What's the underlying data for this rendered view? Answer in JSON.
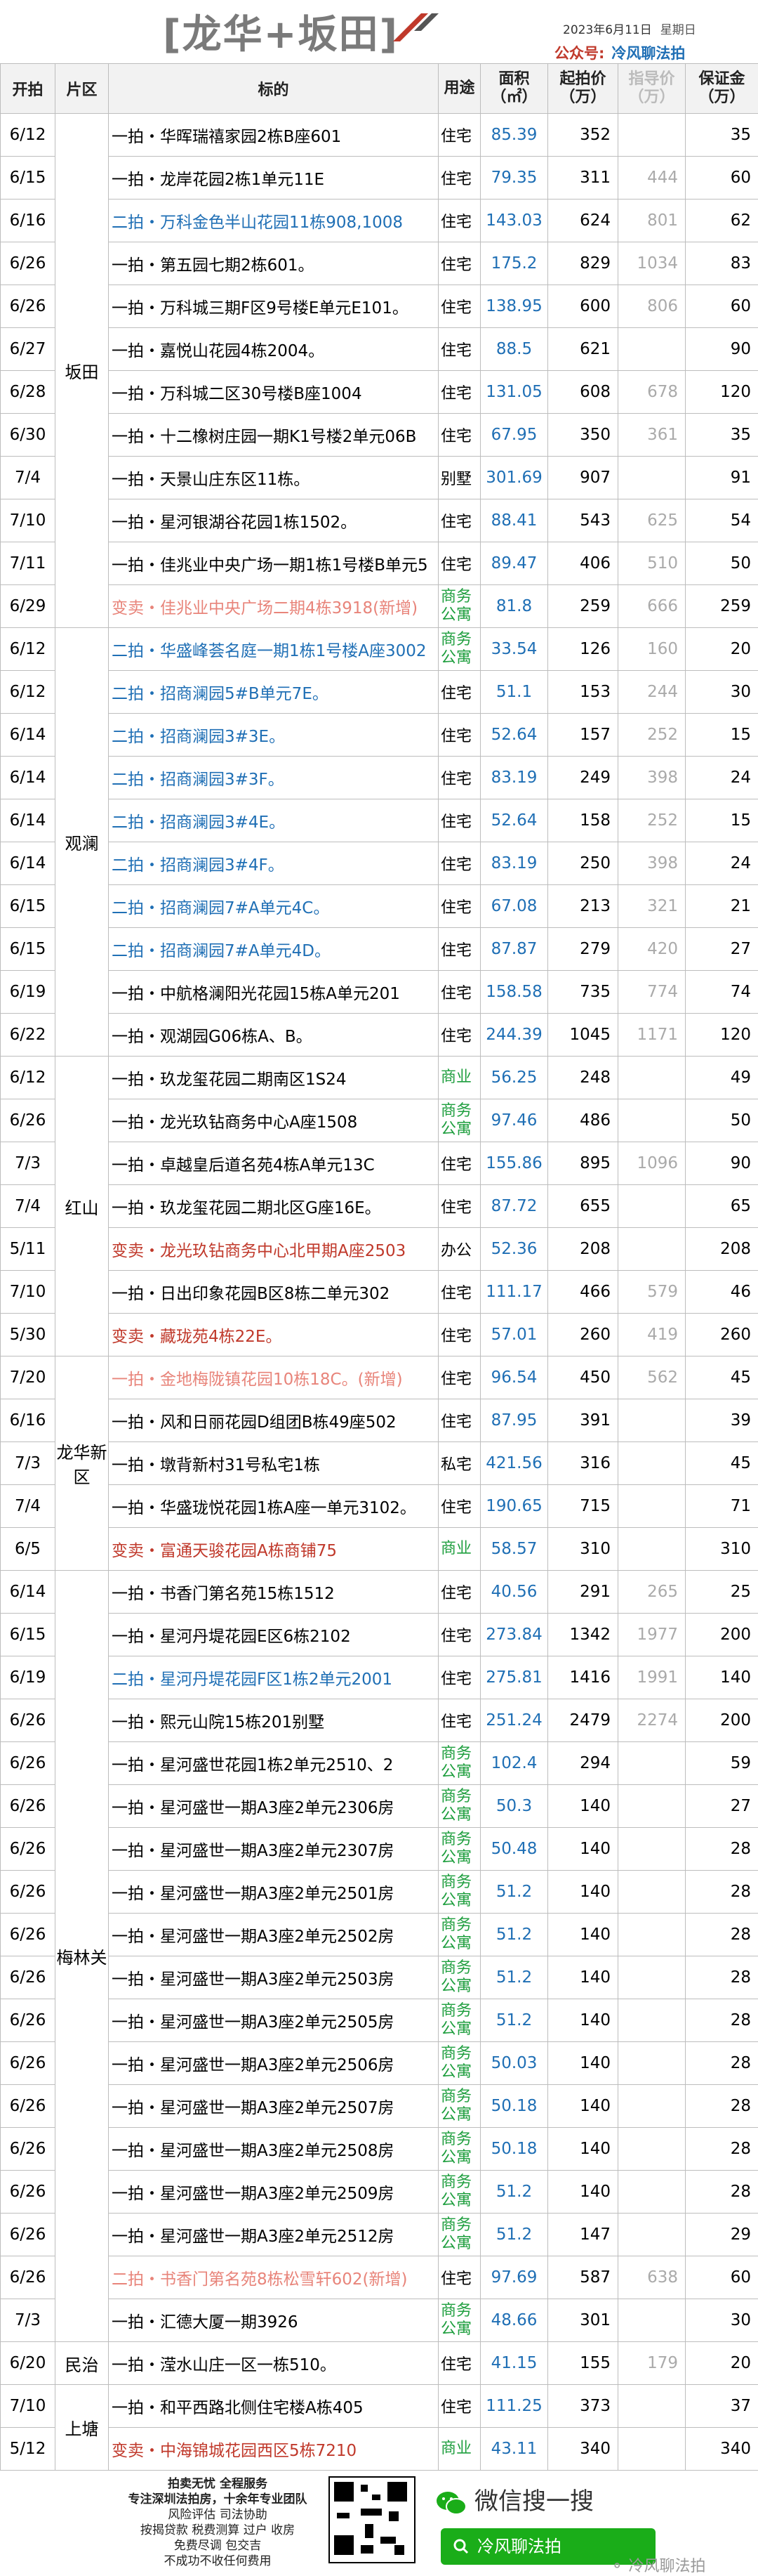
{
  "header": {
    "title": "[龙华+坂田]",
    "date": "2023年6月11日",
    "weekday": "星期日",
    "account_label": "公众号:",
    "account_name": "冷风聊法拍"
  },
  "columns": {
    "date": "开拍",
    "district": "片区",
    "name": "标的",
    "use": "用途",
    "area": "面积（㎡）",
    "start": "起拍价（万）",
    "guide": "指导价（万）",
    "deposit": "保证金（万）"
  },
  "groups": [
    {
      "district": "坂田",
      "rows": [
        {
          "date": "6/12",
          "name": "一拍・华晖瑞禧家园2栋B座601",
          "use": "住宅",
          "area": "85.39",
          "start": "352",
          "guide": "",
          "deposit": "35",
          "style": "normal"
        },
        {
          "date": "6/15",
          "name": "一拍・龙岸花园2栋1单元11E",
          "use": "住宅",
          "area": "79.35",
          "start": "311",
          "guide": "444",
          "deposit": "60",
          "style": "normal"
        },
        {
          "date": "6/16",
          "name": "二拍・万科金色半山花园11栋908,1008",
          "use": "住宅",
          "area": "143.03",
          "start": "624",
          "guide": "801",
          "deposit": "62",
          "style": "blue"
        },
        {
          "date": "6/26",
          "name": "一拍・第五园七期2栋601。",
          "use": "住宅",
          "area": "175.2",
          "start": "829",
          "guide": "1034",
          "deposit": "83",
          "style": "normal"
        },
        {
          "date": "6/26",
          "name": "一拍・万科城三期F区9号楼E单元E101。",
          "use": "住宅",
          "area": "138.95",
          "start": "600",
          "guide": "806",
          "deposit": "60",
          "style": "normal"
        },
        {
          "date": "6/27",
          "name": "一拍・嘉悦山花园4栋2004。",
          "use": "住宅",
          "area": "88.5",
          "start": "621",
          "guide": "",
          "deposit": "90",
          "style": "normal"
        },
        {
          "date": "6/28",
          "name": "一拍・万科城二区30号楼B座1004",
          "use": "住宅",
          "area": "131.05",
          "start": "608",
          "guide": "678",
          "deposit": "120",
          "style": "normal"
        },
        {
          "date": "6/30",
          "name": "一拍・十二橡树庄园一期K1号楼2单元06B",
          "use": "住宅",
          "area": "67.95",
          "start": "350",
          "guide": "361",
          "deposit": "35",
          "style": "normal"
        },
        {
          "date": "7/4",
          "name": "一拍・天景山庄东区11栋。",
          "use": "别墅",
          "area": "301.69",
          "start": "907",
          "guide": "",
          "deposit": "91",
          "style": "normal"
        },
        {
          "date": "7/10",
          "name": "一拍・星河银湖谷花园1栋1502。",
          "use": "住宅",
          "area": "88.41",
          "start": "543",
          "guide": "625",
          "deposit": "54",
          "style": "normal"
        },
        {
          "date": "7/11",
          "name": "一拍・佳兆业中央广场一期1栋1号楼B单元5",
          "use": "住宅",
          "area": "89.47",
          "start": "406",
          "guide": "510",
          "deposit": "50",
          "style": "normal"
        },
        {
          "date": "6/29",
          "name": "变卖・佳兆业中央广场二期4栋3918(新增)",
          "use": "商务公寓",
          "area": "81.8",
          "start": "259",
          "guide": "666",
          "deposit": "259",
          "style": "pink"
        }
      ]
    },
    {
      "district": "观澜",
      "rows": [
        {
          "date": "6/12",
          "name": "二拍・华盛峰荟名庭一期1栋1号楼A座3002",
          "use": "商务公寓",
          "area": "33.54",
          "start": "126",
          "guide": "160",
          "deposit": "20",
          "style": "blue"
        },
        {
          "date": "6/12",
          "name": "二拍・招商澜园5#B单元7E。",
          "use": "住宅",
          "area": "51.1",
          "start": "153",
          "guide": "244",
          "deposit": "30",
          "style": "blue"
        },
        {
          "date": "6/14",
          "name": "二拍・招商澜园3#3E。",
          "use": "住宅",
          "area": "52.64",
          "start": "157",
          "guide": "252",
          "deposit": "15",
          "style": "blue"
        },
        {
          "date": "6/14",
          "name": "二拍・招商澜园3#3F。",
          "use": "住宅",
          "area": "83.19",
          "start": "249",
          "guide": "398",
          "deposit": "24",
          "style": "blue"
        },
        {
          "date": "6/14",
          "name": "二拍・招商澜园3#4E。",
          "use": "住宅",
          "area": "52.64",
          "start": "158",
          "guide": "252",
          "deposit": "15",
          "style": "blue"
        },
        {
          "date": "6/14",
          "name": "二拍・招商澜园3#4F。",
          "use": "住宅",
          "area": "83.19",
          "start": "250",
          "guide": "398",
          "deposit": "24",
          "style": "blue"
        },
        {
          "date": "6/15",
          "name": "二拍・招商澜园7#A单元4C。",
          "use": "住宅",
          "area": "67.08",
          "start": "213",
          "guide": "321",
          "deposit": "21",
          "style": "blue"
        },
        {
          "date": "6/15",
          "name": "二拍・招商澜园7#A单元4D。",
          "use": "住宅",
          "area": "87.87",
          "start": "279",
          "guide": "420",
          "deposit": "27",
          "style": "blue"
        },
        {
          "date": "6/19",
          "name": "一拍・中航格澜阳光花园15栋A单元201",
          "use": "住宅",
          "area": "158.58",
          "start": "735",
          "guide": "774",
          "deposit": "74",
          "style": "normal"
        },
        {
          "date": "6/22",
          "name": "一拍・观湖园G06栋A、B。",
          "use": "住宅",
          "area": "244.39",
          "start": "1045",
          "guide": "1171",
          "deposit": "120",
          "style": "normal"
        }
      ]
    },
    {
      "district": "红山",
      "rows": [
        {
          "date": "6/12",
          "name": "一拍・玖龙玺花园二期南区1S24",
          "use": "商业",
          "area": "56.25",
          "start": "248",
          "guide": "",
          "deposit": "49",
          "style": "normal"
        },
        {
          "date": "6/26",
          "name": "一拍・龙光玖钻商务中心A座1508",
          "use": "商务公寓",
          "area": "97.46",
          "start": "486",
          "guide": "",
          "deposit": "50",
          "style": "normal"
        },
        {
          "date": "7/3",
          "name": "一拍・卓越皇后道名苑4栋A单元13C",
          "use": "住宅",
          "area": "155.86",
          "start": "895",
          "guide": "1096",
          "deposit": "90",
          "style": "normal"
        },
        {
          "date": "7/4",
          "name": "一拍・玖龙玺花园二期北区G座16E。",
          "use": "住宅",
          "area": "87.72",
          "start": "655",
          "guide": "",
          "deposit": "65",
          "style": "normal"
        },
        {
          "date": "5/11",
          "name": "变卖・龙光玖钻商务中心北甲期A座2503",
          "use": "办公",
          "area": "52.36",
          "start": "208",
          "guide": "",
          "deposit": "208",
          "style": "red"
        },
        {
          "date": "7/10",
          "name": "一拍・日出印象花园B区8栋二单元302",
          "use": "住宅",
          "area": "111.17",
          "start": "466",
          "guide": "579",
          "deposit": "46",
          "style": "normal"
        },
        {
          "date": "5/30",
          "name": "变卖・藏珑苑4栋22E。",
          "use": "住宅",
          "area": "57.01",
          "start": "260",
          "guide": "419",
          "deposit": "260",
          "style": "red"
        }
      ]
    },
    {
      "district": "龙华新区",
      "rows": [
        {
          "date": "7/20",
          "name": "一拍・金地梅陇镇花园10栋18C。(新增)",
          "use": "住宅",
          "area": "96.54",
          "start": "450",
          "guide": "562",
          "deposit": "45",
          "style": "pink"
        },
        {
          "date": "6/16",
          "name": "一拍・风和日丽花园D组团B栋49座502",
          "use": "住宅",
          "area": "87.95",
          "start": "391",
          "guide": "",
          "deposit": "39",
          "style": "normal"
        },
        {
          "date": "7/3",
          "name": "一拍・墩背新村31号私宅1栋",
          "use": "私宅",
          "area": "421.56",
          "start": "316",
          "guide": "",
          "deposit": "45",
          "style": "normal"
        },
        {
          "date": "7/4",
          "name": "一拍・华盛珑悦花园1栋A座一单元3102。",
          "use": "住宅",
          "area": "190.65",
          "start": "715",
          "guide": "",
          "deposit": "71",
          "style": "normal"
        },
        {
          "date": "6/5",
          "name": "变卖・富通天骏花园A栋商铺75",
          "use": "商业",
          "area": "58.57",
          "start": "310",
          "guide": "",
          "deposit": "310",
          "style": "red"
        }
      ]
    },
    {
      "district": "梅林关",
      "rows": [
        {
          "date": "6/14",
          "name": "一拍・书香门第名苑15栋1512",
          "use": "住宅",
          "area": "40.56",
          "start": "291",
          "guide": "265",
          "deposit": "25",
          "style": "normal"
        },
        {
          "date": "6/15",
          "name": "一拍・星河丹堤花园E区6栋2102",
          "use": "住宅",
          "area": "273.84",
          "start": "1342",
          "guide": "1977",
          "deposit": "200",
          "style": "normal"
        },
        {
          "date": "6/19",
          "name": "二拍・星河丹堤花园F区1栋2单元2001",
          "use": "住宅",
          "area": "275.81",
          "start": "1416",
          "guide": "1991",
          "deposit": "140",
          "style": "blue"
        },
        {
          "date": "6/26",
          "name": "一拍・熙元山院15栋201别墅",
          "use": "住宅",
          "area": "251.24",
          "start": "2479",
          "guide": "2274",
          "deposit": "200",
          "style": "normal"
        },
        {
          "date": "6/26",
          "name": "一拍・星河盛世花园1栋2单元2510、2",
          "use": "商务公寓",
          "area": "102.4",
          "start": "294",
          "guide": "",
          "deposit": "59",
          "style": "normal"
        },
        {
          "date": "6/26",
          "name": "一拍・星河盛世一期A3座2单元2306房",
          "use": "商务公寓",
          "area": "50.3",
          "start": "140",
          "guide": "",
          "deposit": "27",
          "style": "normal"
        },
        {
          "date": "6/26",
          "name": "一拍・星河盛世一期A3座2单元2307房",
          "use": "商务公寓",
          "area": "50.48",
          "start": "140",
          "guide": "",
          "deposit": "28",
          "style": "normal"
        },
        {
          "date": "6/26",
          "name": "一拍・星河盛世一期A3座2单元2501房",
          "use": "商务公寓",
          "area": "51.2",
          "start": "140",
          "guide": "",
          "deposit": "28",
          "style": "normal"
        },
        {
          "date": "6/26",
          "name": "一拍・星河盛世一期A3座2单元2502房",
          "use": "商务公寓",
          "area": "51.2",
          "start": "140",
          "guide": "",
          "deposit": "28",
          "style": "normal"
        },
        {
          "date": "6/26",
          "name": "一拍・星河盛世一期A3座2单元2503房",
          "use": "商务公寓",
          "area": "51.2",
          "start": "140",
          "guide": "",
          "deposit": "28",
          "style": "normal"
        },
        {
          "date": "6/26",
          "name": "一拍・星河盛世一期A3座2单元2505房",
          "use": "商务公寓",
          "area": "51.2",
          "start": "140",
          "guide": "",
          "deposit": "28",
          "style": "normal"
        },
        {
          "date": "6/26",
          "name": "一拍・星河盛世一期A3座2单元2506房",
          "use": "商务公寓",
          "area": "50.03",
          "start": "140",
          "guide": "",
          "deposit": "28",
          "style": "normal"
        },
        {
          "date": "6/26",
          "name": "一拍・星河盛世一期A3座2单元2507房",
          "use": "商务公寓",
          "area": "50.18",
          "start": "140",
          "guide": "",
          "deposit": "28",
          "style": "normal"
        },
        {
          "date": "6/26",
          "name": "一拍・星河盛世一期A3座2单元2508房",
          "use": "商务公寓",
          "area": "50.18",
          "start": "140",
          "guide": "",
          "deposit": "28",
          "style": "normal"
        },
        {
          "date": "6/26",
          "name": "一拍・星河盛世一期A3座2单元2509房",
          "use": "商务公寓",
          "area": "51.2",
          "start": "140",
          "guide": "",
          "deposit": "28",
          "style": "normal"
        },
        {
          "date": "6/26",
          "name": "一拍・星河盛世一期A3座2单元2512房",
          "use": "商务公寓",
          "area": "51.2",
          "start": "147",
          "guide": "",
          "deposit": "29",
          "style": "normal"
        },
        {
          "date": "6/26",
          "name": "二拍・书香门第名苑8栋松雪轩602(新增)",
          "use": "住宅",
          "area": "97.69",
          "start": "587",
          "guide": "638",
          "deposit": "60",
          "style": "pink"
        },
        {
          "date": "7/3",
          "name": "一拍・汇德大厦一期3926",
          "use": "商务公寓",
          "area": "48.66",
          "start": "301",
          "guide": "",
          "deposit": "30",
          "style": "normal"
        }
      ]
    },
    {
      "district": "民治",
      "rows": [
        {
          "date": "6/20",
          "name": "一拍・滢水山庄一区一栋510。",
          "use": "住宅",
          "area": "41.15",
          "start": "155",
          "guide": "179",
          "deposit": "20",
          "style": "normal"
        }
      ]
    },
    {
      "district": "上塘",
      "rows": [
        {
          "date": "7/10",
          "name": "一拍・和平西路北侧住宅楼A栋405",
          "use": "住宅",
          "area": "111.25",
          "start": "373",
          "guide": "",
          "deposit": "37",
          "style": "normal"
        },
        {
          "date": "5/12",
          "name": "变卖・中海锦城花园西区5栋7210",
          "use": "商业",
          "area": "43.11",
          "start": "340",
          "guide": "",
          "deposit": "340",
          "style": "red"
        }
      ]
    }
  ],
  "footer": {
    "lines": [
      "拍卖无忧 全程服务",
      "专注深圳法拍房，十余年专业团队",
      "风险评估 司法协助",
      "按揭贷款 税费测算 过户 收房",
      "免费尽调 包交吉",
      "不成功不收任何费用"
    ],
    "wechat_label": "微信搜一搜",
    "search_button": "冷风聊法拍",
    "watermark": "冷风聊法拍"
  }
}
